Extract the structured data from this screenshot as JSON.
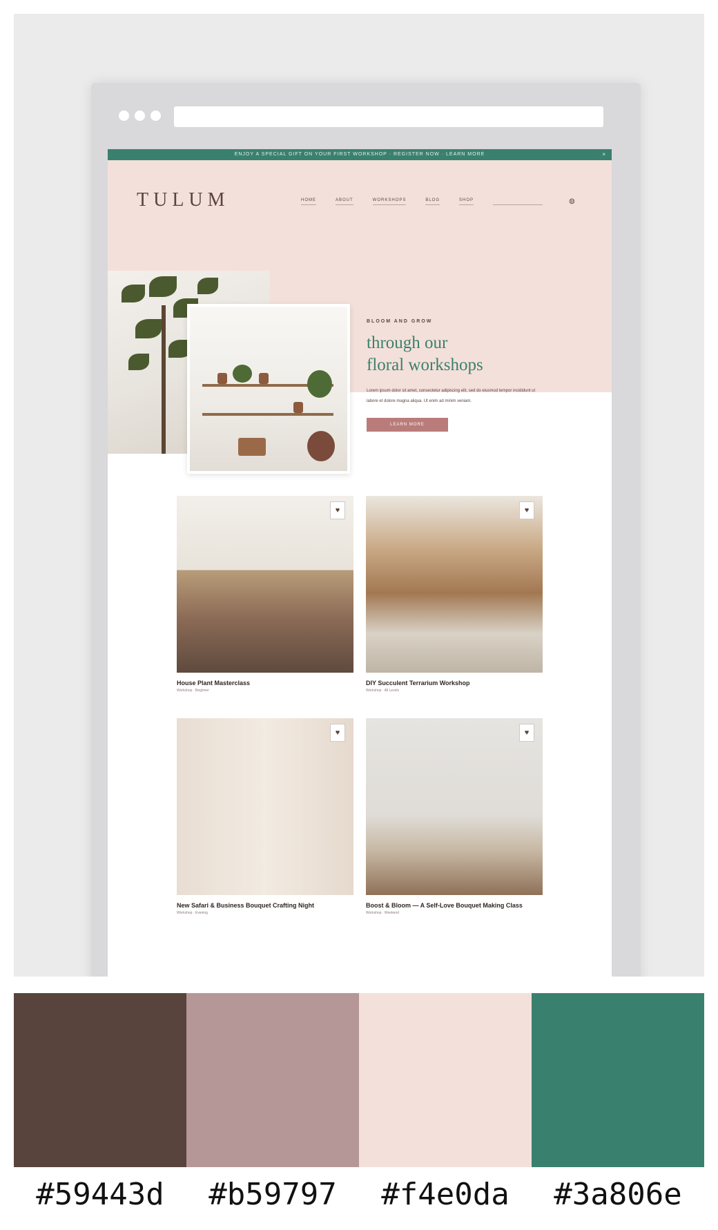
{
  "site": {
    "announcement": "ENJOY A SPECIAL GIFT ON YOUR FIRST WORKSHOP · REGISTER NOW · LEARN MORE",
    "announcement_close": "×",
    "logo": "TULUM",
    "nav": [
      "HOME",
      "ABOUT",
      "WORKSHOPS",
      "BLOG",
      "SHOP"
    ],
    "cart_icon": "cart-icon",
    "hero": {
      "eyebrow": "BLOOM AND GROW",
      "title_line1": "through our",
      "title_line2": "floral workshops",
      "body": "Lorem ipsum dolor sit amet, consectetur adipiscing elit, sed do eiusmod tempor incididunt ut labore et dolore magna aliqua. Ut enim ad minim veniam.",
      "button": "LEARN MORE"
    },
    "cards": [
      {
        "title": "House Plant Masterclass",
        "sub": "Workshop · Beginner",
        "badge": "♥"
      },
      {
        "title": "DIY Succulent Terrarium Workshop",
        "sub": "Workshop · All Levels",
        "badge": "♥"
      },
      {
        "title": "New Safari & Business Bouquet Crafting Night",
        "sub": "Workshop · Evening",
        "badge": "♥"
      },
      {
        "title": "Boost & Bloom — A Self-Love Bouquet Making Class",
        "sub": "Workshop · Weekend",
        "badge": "♥"
      }
    ],
    "progress_fraction": 0.59
  },
  "palette": [
    {
      "hex": "#59443d",
      "label": "#59443d"
    },
    {
      "hex": "#b59797",
      "label": "#b59797"
    },
    {
      "hex": "#f4e0da",
      "label": "#f4e0da"
    },
    {
      "hex": "#3a806e",
      "label": "#3a806e"
    }
  ]
}
